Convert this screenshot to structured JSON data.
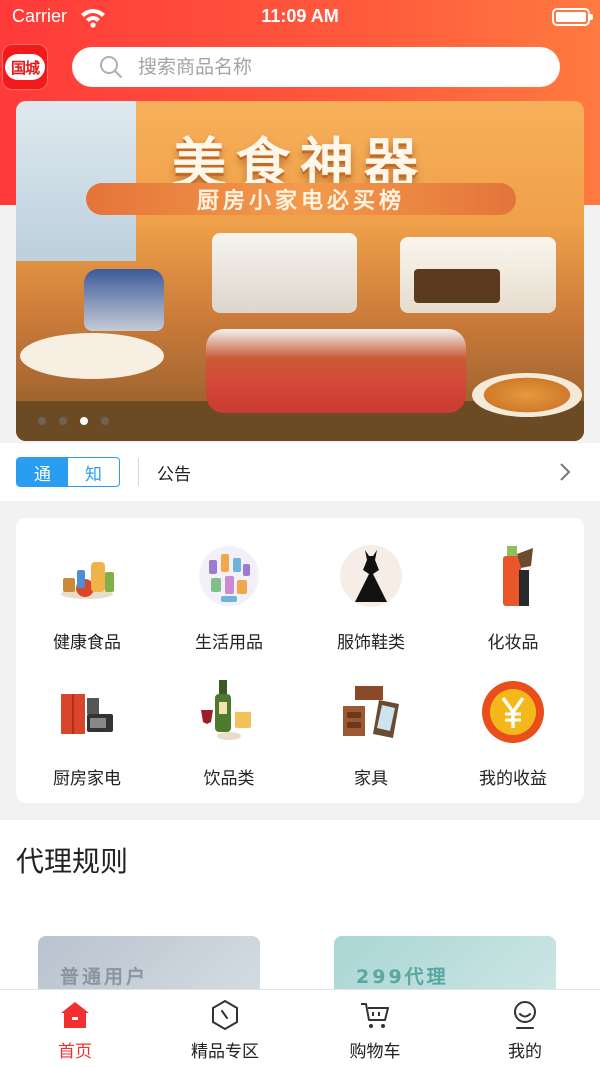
{
  "status_bar": {
    "carrier": "Carrier",
    "time": "11:09 AM"
  },
  "header": {
    "logo_text": "国城",
    "search_placeholder": "搜索商品名称"
  },
  "banner": {
    "title": "美食神器",
    "subtitle": "厨房小家电必买榜",
    "dot_count": 4,
    "active_dot_index": 2
  },
  "notice": {
    "badge_left": "通",
    "badge_right": "知",
    "text": "公告"
  },
  "categories": [
    {
      "label": "健康食品",
      "icon": "healthy-food-icon"
    },
    {
      "label": "生活用品",
      "icon": "daily-goods-icon"
    },
    {
      "label": "服饰鞋类",
      "icon": "dress-icon"
    },
    {
      "label": "化妆品",
      "icon": "cosmetics-icon"
    },
    {
      "label": "厨房家电",
      "icon": "kitchen-appliance-icon"
    },
    {
      "label": "饮品类",
      "icon": "drinks-icon"
    },
    {
      "label": "家具",
      "icon": "furniture-icon"
    },
    {
      "label": "我的收益",
      "icon": "yuan-coin-icon"
    }
  ],
  "rules": {
    "title": "代理规则",
    "plans": [
      {
        "label": "普通用户"
      },
      {
        "label": "299代理"
      }
    ]
  },
  "tabbar": [
    {
      "label": "首页",
      "icon": "home-icon",
      "active": true
    },
    {
      "label": "精品专区",
      "icon": "premium-zone-icon",
      "active": false
    },
    {
      "label": "购物车",
      "icon": "cart-icon",
      "active": false
    },
    {
      "label": "我的",
      "icon": "profile-icon",
      "active": false
    }
  ],
  "colors": {
    "brand_red": "#f23030",
    "notice_blue": "#2b9df0"
  }
}
